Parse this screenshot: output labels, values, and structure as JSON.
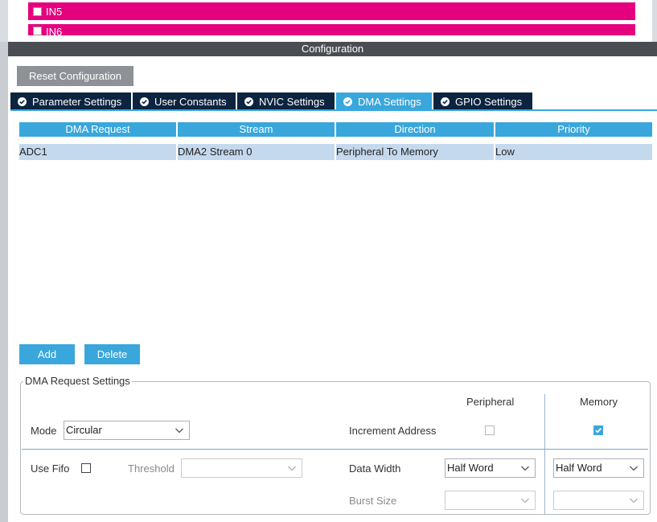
{
  "pins": [
    {
      "label": "IN5"
    },
    {
      "label": "IN6"
    }
  ],
  "config": {
    "title": "Configuration",
    "reset_label": "Reset Configuration"
  },
  "tabs": [
    {
      "label": "Parameter Settings",
      "active": false
    },
    {
      "label": "User Constants",
      "active": false
    },
    {
      "label": "NVIC Settings",
      "active": false
    },
    {
      "label": "DMA Settings",
      "active": true
    },
    {
      "label": "GPIO Settings",
      "active": false
    }
  ],
  "dma_table": {
    "columns": [
      "DMA Request",
      "Stream",
      "Direction",
      "Priority"
    ],
    "rows": [
      [
        "ADC1",
        "DMA2 Stream 0",
        "Peripheral To Memory",
        "Low"
      ]
    ]
  },
  "buttons": {
    "add": "Add",
    "delete": "Delete"
  },
  "settings": {
    "legend": "DMA Request Settings",
    "peripheral_header": "Peripheral",
    "memory_header": "Memory",
    "mode_label": "Mode",
    "mode_value": "Circular",
    "increment_label": "Increment Address",
    "peripheral_increment": false,
    "memory_increment": true,
    "use_fifo_label": "Use Fifo",
    "use_fifo": false,
    "threshold_label": "Threshold",
    "threshold_value": "",
    "data_width_label": "Data Width",
    "peripheral_data_width": "Half Word",
    "memory_data_width": "Half Word",
    "burst_size_label": "Burst Size",
    "peripheral_burst": "",
    "memory_burst": ""
  },
  "colors": {
    "pin_row": "#e5007e",
    "accent": "#39a7dc",
    "tab_dark": "#0c2440",
    "header_bar": "#4a4d52",
    "row_selected": "#c5d9ee"
  }
}
